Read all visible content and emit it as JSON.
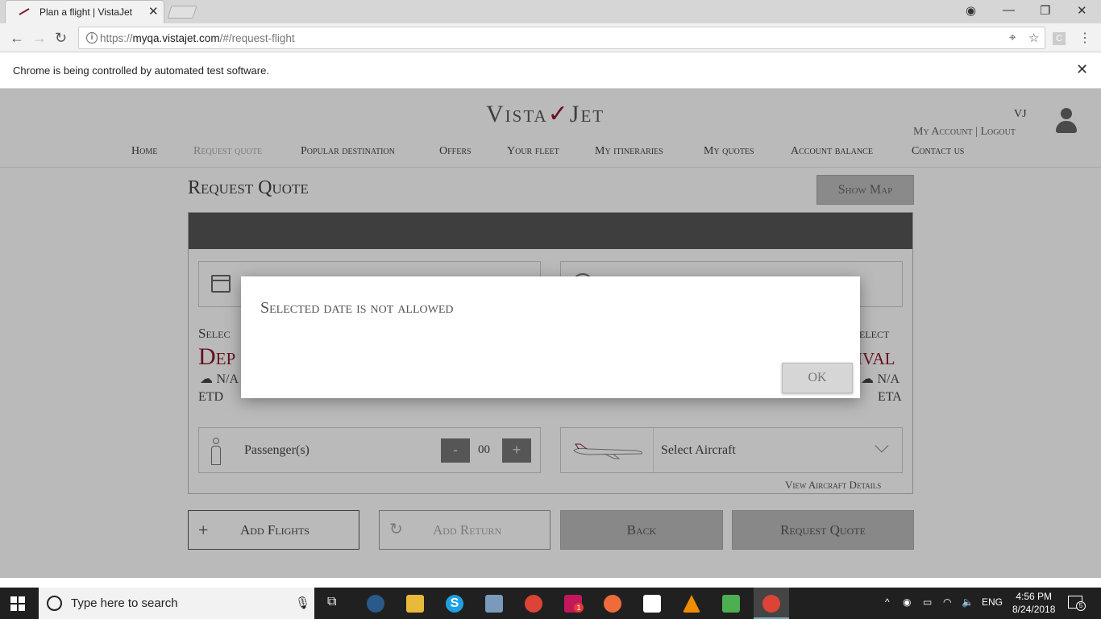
{
  "browser": {
    "tab_title": "Plan a flight | VistaJet",
    "url_prefix": "https://",
    "url_host": "myqa.vistajet.com",
    "url_path": "/#/request-flight",
    "infobar_message": "Chrome is being controlled by automated test software.",
    "extension_label": "C"
  },
  "header": {
    "logo": "VistaJet",
    "user_initials": "VJ",
    "my_account": "My Account",
    "separator": "|",
    "logout": "Logout",
    "nav": [
      {
        "label": "Home"
      },
      {
        "label": "Request quote"
      },
      {
        "label": "Popular destination"
      },
      {
        "label": "Offers"
      },
      {
        "label": "Your fleet"
      },
      {
        "label": "My itineraries"
      },
      {
        "label": "My quotes"
      },
      {
        "label": "Account balance"
      },
      {
        "label": "Contact us"
      }
    ],
    "active_nav": "Request quote"
  },
  "main": {
    "title": "Request Quote",
    "show_map": "Show Map",
    "departure": {
      "select_label": "Selec",
      "title": "Dep",
      "weather": "N/A",
      "time_label": "ETD"
    },
    "arrival": {
      "select_label": "elect",
      "title": "ival",
      "weather": "N/A",
      "time_label": "ETA"
    },
    "passengers": {
      "label": "Passenger(s)",
      "minus": "-",
      "value": "00",
      "plus": "+"
    },
    "aircraft": {
      "placeholder": "Select Aircraft"
    },
    "view_details": "View Aircraft Details",
    "buttons": {
      "add_flights_icon": "+",
      "add_flights": "Add Flights",
      "add_return_icon": "↻",
      "add_return": "Add Return",
      "back": "Back",
      "request_quote": "Request Quote"
    }
  },
  "dialog": {
    "message": "Selected date is not allowed",
    "ok": "OK"
  },
  "taskbar": {
    "search_placeholder": "Type here to search",
    "language": "ENG",
    "time": "4:56 PM",
    "date": "8/24/2018",
    "notification_count": "5",
    "badge_count": "1"
  },
  "colors": {
    "brand_red": "#8b1a2b",
    "card_header": "#555555",
    "taskbar": "#202020"
  }
}
